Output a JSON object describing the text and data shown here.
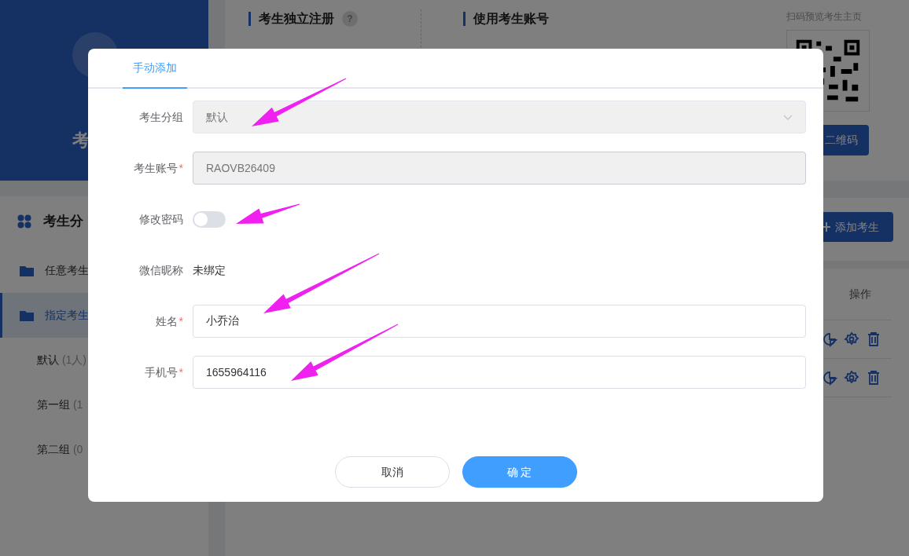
{
  "background": {
    "profile_card": {
      "title": "考"
    },
    "registration": {
      "independent": {
        "title": "考生独立注册",
        "help": "?"
      },
      "account": {
        "title": "使用考生账号"
      },
      "qr": {
        "caption": "扫码预览考生主页",
        "button": "二维码"
      }
    },
    "groups_panel": {
      "title": "考生分",
      "items": [
        {
          "label": "任意考生",
          "kind": "folder",
          "selected": false
        },
        {
          "label": "指定考生",
          "kind": "folder",
          "selected": true
        },
        {
          "label": "默认",
          "count": "(1人)",
          "kind": "group",
          "selected": false
        },
        {
          "label": "第一组",
          "count": "(1",
          "kind": "group",
          "selected": false
        },
        {
          "label": "第二组",
          "count": "(0",
          "kind": "group",
          "selected": false
        }
      ]
    },
    "add_button": "添加考生",
    "table": {
      "columns": [
        "操作"
      ]
    }
  },
  "dialog": {
    "tabs": [
      {
        "label": "手动添加",
        "selected": true
      }
    ],
    "fields": [
      {
        "kind": "select",
        "label": "考生分组",
        "value": "默认",
        "disabled": true
      },
      {
        "kind": "input",
        "label": "考生账号",
        "required_mark": "*",
        "value": "RAOVB26409",
        "disabled": true
      },
      {
        "kind": "toggle",
        "label": "修改密码",
        "on": false
      },
      {
        "kind": "text",
        "label": "微信昵称",
        "value": "未绑定"
      },
      {
        "kind": "input",
        "label": "姓名",
        "required_mark": "*",
        "value": "小乔治",
        "disabled": false
      },
      {
        "kind": "input",
        "label": "手机号",
        "required_mark": "*",
        "value": "1655964116",
        "disabled": false
      }
    ],
    "buttons": [
      {
        "label": "取消",
        "kind": "secondary"
      },
      {
        "label": "确 定",
        "kind": "primary"
      }
    ]
  }
}
